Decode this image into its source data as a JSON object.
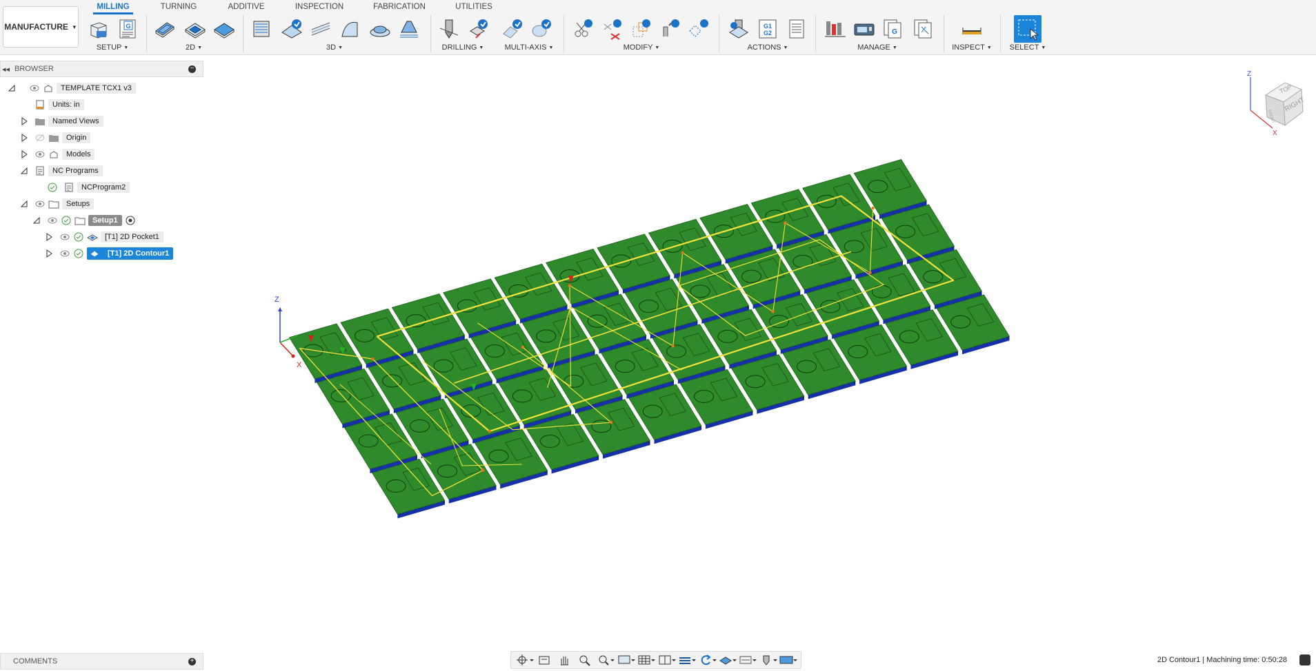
{
  "workspace": {
    "label": "MANUFACTURE"
  },
  "tabs": [
    "MILLING",
    "TURNING",
    "ADDITIVE",
    "INSPECTION",
    "FABRICATION",
    "UTILITIES"
  ],
  "groups": {
    "setup": "SETUP",
    "g2d": "2D",
    "g3d": "3D",
    "drilling": "DRILLING",
    "multiaxis": "MULTI-AXIS",
    "modify": "MODIFY",
    "actions": "ACTIONS",
    "manage": "MANAGE",
    "inspect": "INSPECT",
    "select": "SELECT"
  },
  "icons": {
    "gcode_badge": "G",
    "actions_g1": "G1",
    "actions_g2": "G2"
  },
  "browser": {
    "title": "BROWSER",
    "items": {
      "root": "TEMPLATE TCX1 v3",
      "units": "Units: in",
      "named_views": "Named Views",
      "origin": "Origin",
      "models": "Models",
      "nc_programs": "NC Programs",
      "nc_program2": "NCProgram2",
      "setups": "Setups",
      "setup1": "Setup1",
      "pocket": "[T1] 2D Pocket1",
      "contour": "[T1] 2D Contour1"
    }
  },
  "viewcube": {
    "top": "TOP",
    "right": "RIGHT",
    "front": "FRONT",
    "axis_z": "Z",
    "axis_x": "X"
  },
  "triad": {
    "z_label": "Z",
    "x_label": "X"
  },
  "comments": {
    "title": "COMMENTS"
  },
  "status": {
    "text": "2D Contour1 | Machining time: 0:50:28"
  },
  "colors": {
    "accent": "#1a73c9",
    "selection": "#1b86d9",
    "part": "#2f8a2b",
    "toolpath": "#f4e33a",
    "plate_edge": "#1530a8"
  }
}
